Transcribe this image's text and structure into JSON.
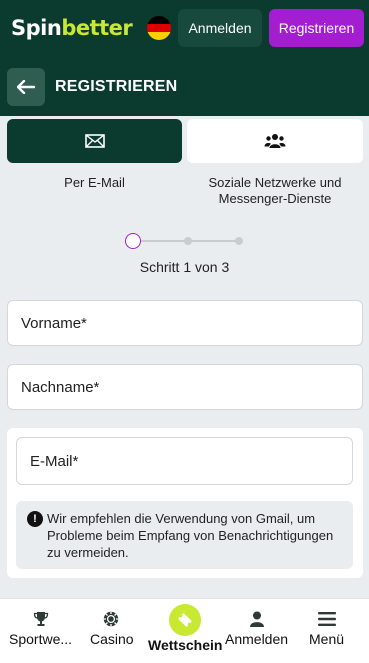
{
  "header": {
    "logo_part1": "Spin",
    "logo_part2": "better",
    "language_flag": "de-flag-icon",
    "login_label": "Anmelden",
    "register_label": "Registrieren"
  },
  "subheader": {
    "title": "REGISTRIEREN"
  },
  "methods": [
    {
      "icon": "envelope-icon",
      "label": "Per E-Mail",
      "selected": true
    },
    {
      "icon": "users-icon",
      "label": "Soziale Netzwerke und Messenger-Dienste",
      "selected": false
    }
  ],
  "progress": {
    "current_step": 1,
    "total_steps": 3,
    "text": "Schritt 1 von 3"
  },
  "form": {
    "first_name_placeholder": "Vorname*",
    "last_name_placeholder": "Nachname*",
    "email_placeholder": "E-Mail*",
    "gmail_note": "Wir empfehlen die Verwendung von Gmail, um Probleme beim Empfang von Benachrichtigungen zu vermeiden."
  },
  "bottom_nav": [
    {
      "icon": "trophy-icon",
      "label": "Sportwe..."
    },
    {
      "icon": "chip-icon",
      "label": "Casino"
    },
    {
      "icon": "ticket-icon",
      "label": "Wettschein"
    },
    {
      "icon": "user-icon",
      "label": "Anmelden"
    },
    {
      "icon": "menu-icon",
      "label": "Menü"
    }
  ],
  "colors": {
    "brand_dark": "#0b3a2f",
    "brand_lime": "#c8e831",
    "accent_purple": "#a21ed0",
    "background": "#e9edf0"
  }
}
